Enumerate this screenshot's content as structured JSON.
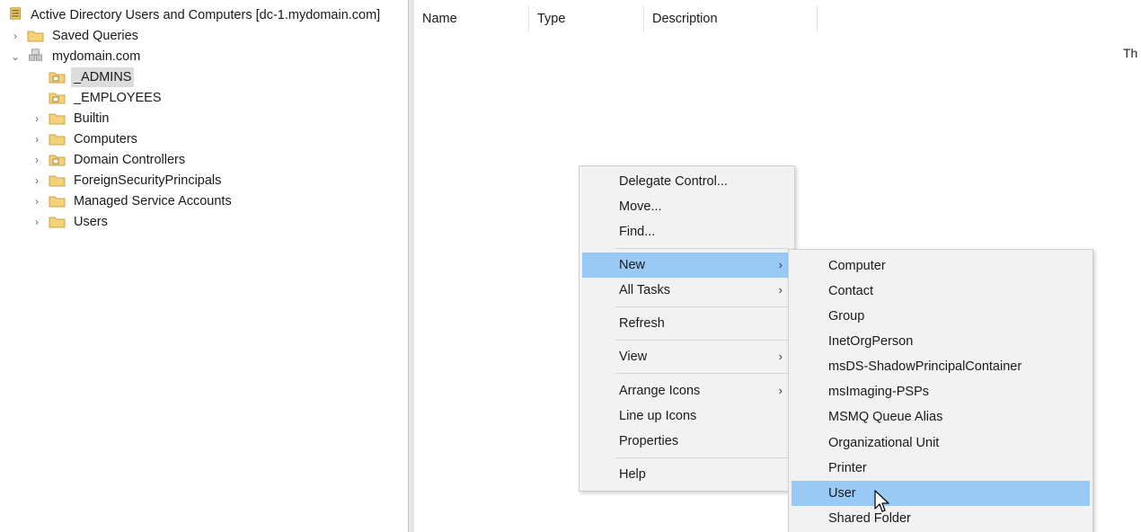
{
  "tree": {
    "root_label": "Active Directory Users and Computers [dc-1.mydomain.com]",
    "items": [
      {
        "label": "Saved Queries"
      },
      {
        "label": "mydomain.com"
      },
      {
        "label": "_ADMINS"
      },
      {
        "label": "_EMPLOYEES"
      },
      {
        "label": "Builtin"
      },
      {
        "label": "Computers"
      },
      {
        "label": "Domain Controllers"
      },
      {
        "label": "ForeignSecurityPrincipals"
      },
      {
        "label": "Managed Service Accounts"
      },
      {
        "label": "Users"
      }
    ]
  },
  "list": {
    "columns": [
      "Name",
      "Type",
      "Description"
    ],
    "empty_text": "Th"
  },
  "context_menu": {
    "items": [
      {
        "label": "Delegate Control..."
      },
      {
        "label": "Move..."
      },
      {
        "label": "Find..."
      },
      {
        "label": "New"
      },
      {
        "label": "All Tasks"
      },
      {
        "label": "Refresh"
      },
      {
        "label": "View"
      },
      {
        "label": "Arrange Icons"
      },
      {
        "label": "Line up Icons"
      },
      {
        "label": "Properties"
      },
      {
        "label": "Help"
      }
    ]
  },
  "new_submenu": {
    "items": [
      {
        "label": "Computer"
      },
      {
        "label": "Contact"
      },
      {
        "label": "Group"
      },
      {
        "label": "InetOrgPerson"
      },
      {
        "label": "msDS-ShadowPrincipalContainer"
      },
      {
        "label": "msImaging-PSPs"
      },
      {
        "label": "MSMQ Queue Alias"
      },
      {
        "label": "Organizational Unit"
      },
      {
        "label": "Printer"
      },
      {
        "label": "User"
      },
      {
        "label": "Shared Folder"
      }
    ]
  },
  "colors": {
    "highlight": "#99c9f5",
    "folder": "#f3d27a",
    "menu_bg": "#f2f2f2"
  }
}
